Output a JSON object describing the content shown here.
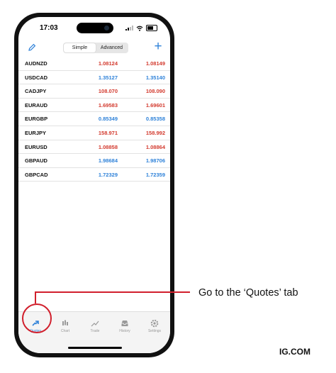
{
  "status": {
    "time": "17:03"
  },
  "toolbar": {
    "tab_simple": "Simple",
    "tab_advanced": "Advanced",
    "add_label": "+"
  },
  "quotes": [
    {
      "symbol": "AUDNZD",
      "bid": "1.08124",
      "ask": "1.08149",
      "bid_color": "red",
      "ask_color": "red"
    },
    {
      "symbol": "USDCAD",
      "bid": "1.35127",
      "ask": "1.35140",
      "bid_color": "blue",
      "ask_color": "blue"
    },
    {
      "symbol": "CADJPY",
      "bid": "108.070",
      "ask": "108.090",
      "bid_color": "red",
      "ask_color": "red"
    },
    {
      "symbol": "EURAUD",
      "bid": "1.69583",
      "ask": "1.69601",
      "bid_color": "red",
      "ask_color": "red"
    },
    {
      "symbol": "EURGBP",
      "bid": "0.85349",
      "ask": "0.85358",
      "bid_color": "blue",
      "ask_color": "blue"
    },
    {
      "symbol": "EURJPY",
      "bid": "158.971",
      "ask": "158.992",
      "bid_color": "red",
      "ask_color": "red"
    },
    {
      "symbol": "EURUSD",
      "bid": "1.08858",
      "ask": "1.08864",
      "bid_color": "red",
      "ask_color": "red"
    },
    {
      "symbol": "GBPAUD",
      "bid": "1.98684",
      "ask": "1.98706",
      "bid_color": "blue",
      "ask_color": "blue"
    },
    {
      "symbol": "GBPCAD",
      "bid": "1.72329",
      "ask": "1.72359",
      "bid_color": "blue",
      "ask_color": "blue"
    }
  ],
  "tabs": [
    {
      "label": "Quotes",
      "icon": "quotes-icon",
      "active": true
    },
    {
      "label": "Chart",
      "icon": "chart-icon",
      "active": false
    },
    {
      "label": "Trade",
      "icon": "trade-icon",
      "active": false
    },
    {
      "label": "History",
      "icon": "history-icon",
      "active": false
    },
    {
      "label": "Settings",
      "icon": "settings-icon",
      "active": false
    }
  ],
  "callout": {
    "text": "Go to the ‘Quotes’ tab"
  },
  "brand": "IG.COM",
  "colors": {
    "red": "#d33a2e",
    "blue": "#2f82d9",
    "callout_red": "#d11f2c"
  }
}
